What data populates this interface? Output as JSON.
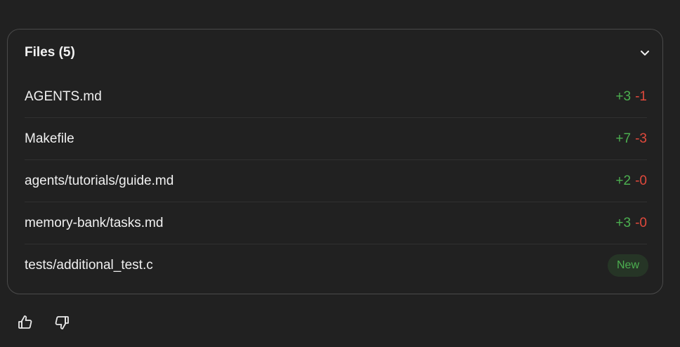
{
  "files_panel": {
    "title": "Files (5)",
    "expand_icon": "chevron-down-icon",
    "files": [
      {
        "name": "AGENTS.md",
        "added": "+3",
        "removed": "-1"
      },
      {
        "name": "Makefile",
        "added": "+7",
        "removed": "-3"
      },
      {
        "name": "agents/tutorials/guide.md",
        "added": "+2",
        "removed": "-0"
      },
      {
        "name": "memory-bank/tasks.md",
        "added": "+3",
        "removed": "-0"
      },
      {
        "name": "tests/additional_test.c",
        "badge": "New"
      }
    ]
  },
  "feedback": {
    "like_icon": "thumbs-up-icon",
    "dislike_icon": "thumbs-down-icon"
  },
  "colors": {
    "background": "#212121",
    "added": "#4caf50",
    "removed": "#e0493c",
    "border": "#4a4a4a"
  }
}
